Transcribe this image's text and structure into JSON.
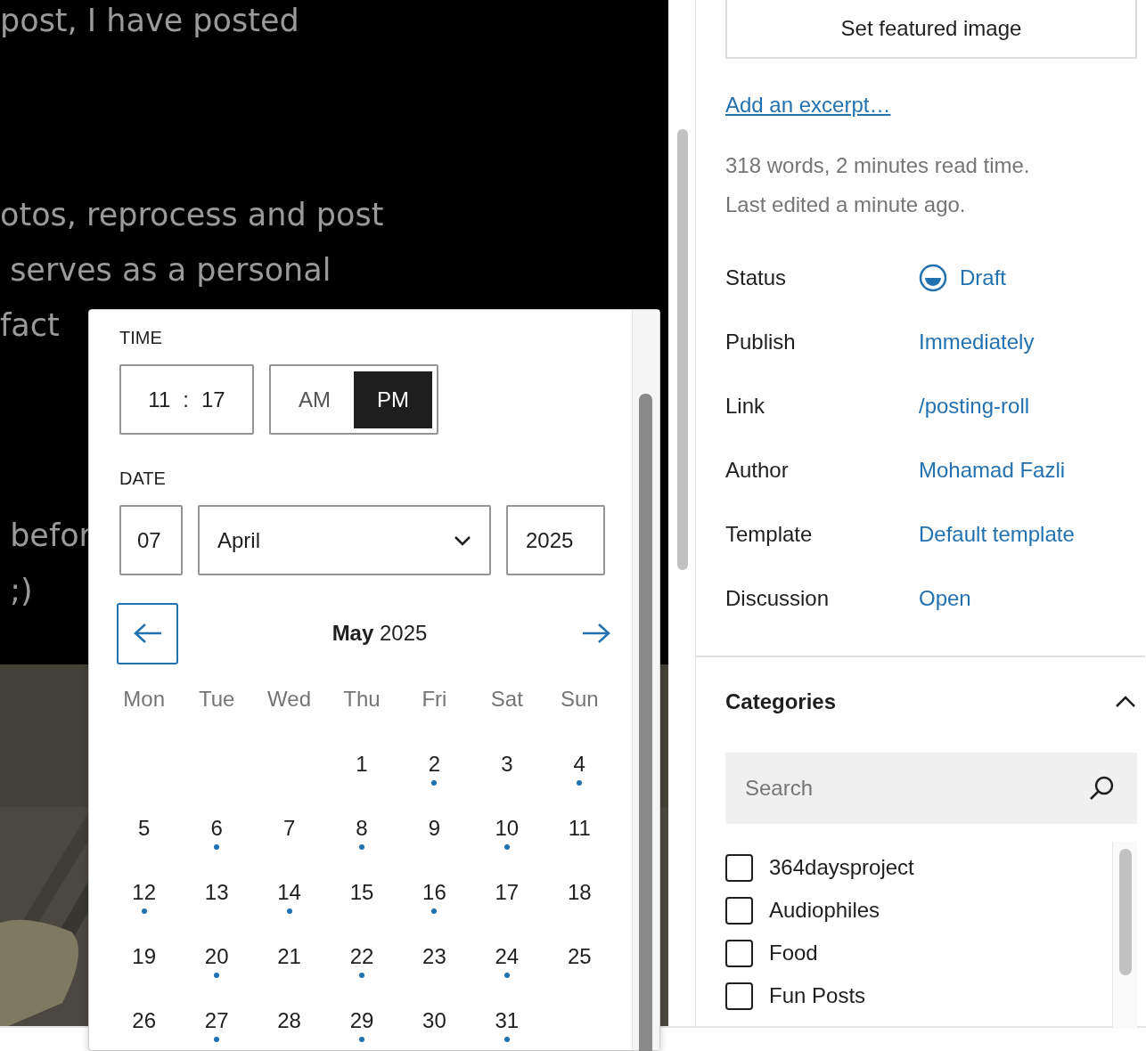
{
  "editor": {
    "paragraphs": [
      [
        "post, I have posted"
      ],
      [
        "otos, reprocess and post",
        " serves as a personal",
        "fact"
      ],
      [
        " befor",
        " ;)"
      ]
    ],
    "photo": {
      "kind": "picture"
    }
  },
  "datetime_popover": {
    "time_label": "TIME",
    "hours": "11",
    "separator": ":",
    "minutes": "17",
    "periods": [
      {
        "label": "AM",
        "selected": false
      },
      {
        "label": "PM",
        "selected": true
      }
    ],
    "date_label": "DATE",
    "day": "07",
    "month": "April",
    "year": "2025",
    "calendar": {
      "title": "**May** 2025",
      "weekdays": [
        "Mon",
        "Tue",
        "Wed",
        "Thu",
        "Fri",
        "Sat",
        "Sun"
      ],
      "weeks": [
        [
          {
            "kind": "empty"
          },
          {
            "kind": "empty"
          },
          {
            "kind": "empty"
          },
          {
            "day": "1",
            "has_posts": false
          },
          {
            "day": "2",
            "has_posts": true
          },
          {
            "day": "3",
            "has_posts": false
          },
          {
            "day": "4",
            "has_posts": true
          }
        ],
        [
          {
            "day": "5",
            "has_posts": false
          },
          {
            "day": "6",
            "has_posts": true
          },
          {
            "day": "7",
            "has_posts": false
          },
          {
            "day": "8",
            "has_posts": true
          },
          {
            "day": "9",
            "has_posts": false
          },
          {
            "day": "10",
            "has_posts": true
          },
          {
            "day": "11",
            "has_posts": false
          }
        ],
        [
          {
            "day": "12",
            "has_posts": true
          },
          {
            "day": "13",
            "has_posts": false
          },
          {
            "day": "14",
            "has_posts": true
          },
          {
            "day": "15",
            "has_posts": false
          },
          {
            "day": "16",
            "has_posts": true
          },
          {
            "day": "17",
            "has_posts": false
          },
          {
            "day": "18",
            "has_posts": false
          }
        ],
        [
          {
            "day": "19",
            "has_posts": false
          },
          {
            "day": "20",
            "has_posts": true
          },
          {
            "day": "21",
            "has_posts": false
          },
          {
            "day": "22",
            "has_posts": true
          },
          {
            "day": "23",
            "has_posts": false
          },
          {
            "day": "24",
            "has_posts": true
          },
          {
            "day": "25",
            "has_posts": false
          }
        ],
        [
          {
            "day": "26",
            "has_posts": false
          },
          {
            "day": "27",
            "has_posts": true
          },
          {
            "day": "28",
            "has_posts": false
          },
          {
            "day": "29",
            "has_posts": true
          },
          {
            "day": "30",
            "has_posts": false
          },
          {
            "day": "31",
            "has_posts": true
          },
          {
            "kind": "empty"
          }
        ]
      ]
    }
  },
  "sidebar": {
    "featured_image_button": "Set featured image",
    "excerpt_link": "Add an excerpt…",
    "stats": [
      "318 words, 2 minutes read time.",
      "Last edited a minute ago."
    ],
    "summary": [
      {
        "label": "Status",
        "value": "Draft",
        "kind": "status"
      },
      {
        "label": "Publish",
        "value": "Immediately",
        "kind": "link"
      },
      {
        "label": "Link",
        "value": "/posting-roll",
        "kind": "link"
      },
      {
        "label": "Author",
        "value": "Mohamad Fazli",
        "kind": "link"
      },
      {
        "label": "Template",
        "value": "Default template",
        "kind": "link"
      },
      {
        "label": "Discussion",
        "value": "Open",
        "kind": "link"
      }
    ],
    "categories": {
      "title": "Categories",
      "expanded": true,
      "search": {
        "placeholder": "Search"
      },
      "items": [
        {
          "label": "364daysproject",
          "checked": false
        },
        {
          "label": "Audiophiles",
          "checked": false
        },
        {
          "label": "Food",
          "checked": false
        },
        {
          "label": "Fun Posts",
          "checked": false
        }
      ]
    }
  }
}
